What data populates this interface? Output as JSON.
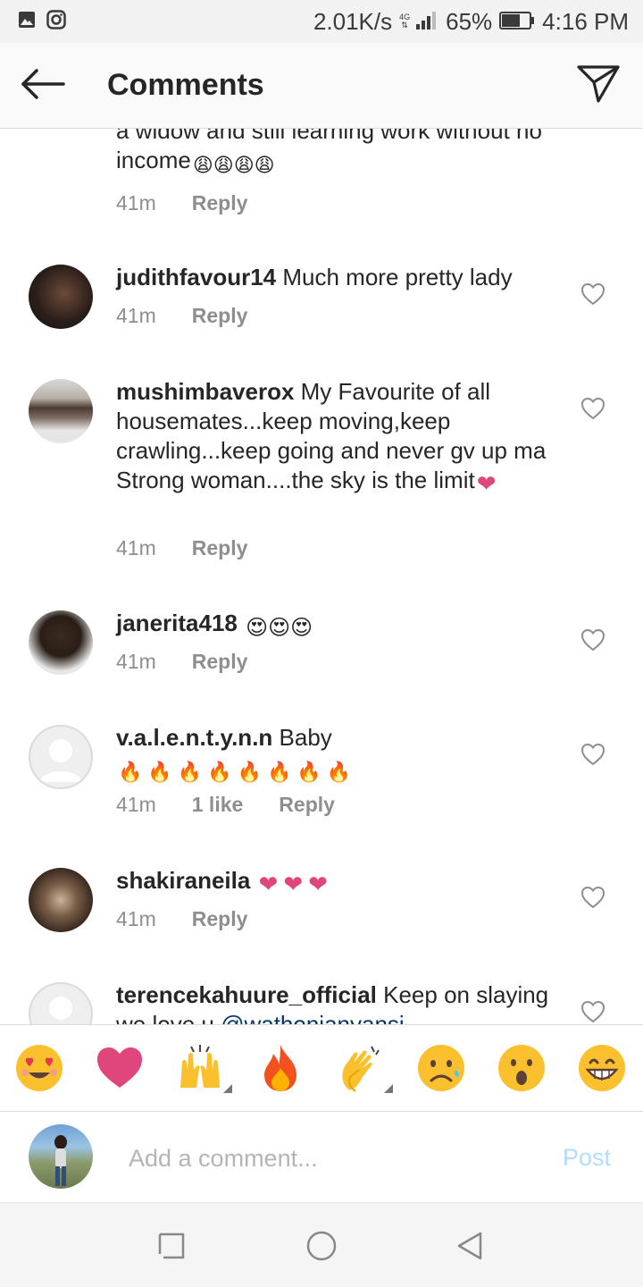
{
  "status_bar": {
    "speed": "2.01K/s",
    "network": "4G",
    "battery": "65%",
    "time": "4:16 PM",
    "icons": [
      "gallery-icon",
      "instagram-icon",
      "signal-icon",
      "battery-icon"
    ]
  },
  "header": {
    "title": "Comments",
    "back_icon": "arrow-left-icon",
    "share_icon": "paper-plane-icon"
  },
  "comments": [
    {
      "username": "",
      "text": "a widow and still learning work without no income",
      "emojis": "😩😩😩😩",
      "time": "41m",
      "likes": "",
      "reply": "Reply"
    },
    {
      "username": "judithfavour14",
      "text": "Much more pretty lady",
      "emojis": "",
      "time": "41m",
      "likes": "",
      "reply": "Reply"
    },
    {
      "username": "mushimbaverox",
      "text": "My Favourite of all housemates...keep moving,keep crawling...keep going and never gv up ma Strong woman....the sky is the limit",
      "emojis": "❤",
      "time": "41m",
      "likes": "",
      "reply": "Reply"
    },
    {
      "username": "janerita418",
      "text": "",
      "emojis": "😍😍😍",
      "time": "41m",
      "likes": "",
      "reply": "Reply"
    },
    {
      "username": "v.a.l.e.n.t.y.n.n",
      "text": "Baby",
      "emojis": "🔥🔥🔥🔥🔥🔥🔥🔥",
      "time": "41m",
      "likes": "1 like",
      "reply": "Reply"
    },
    {
      "username": "shakiraneila",
      "text": "",
      "emojis": "❤❤❤",
      "time": "41m",
      "likes": "",
      "reply": "Reply"
    },
    {
      "username": "terencekahuure_official",
      "text": "Keep on slaying we love u",
      "mention": "@wathonianyansi",
      "time": "",
      "likes": "",
      "reply": ""
    }
  ],
  "emoji_bar": [
    "heart-eyes",
    "red-heart",
    "raising-hands",
    "fire",
    "clapping-hands",
    "frowning-face",
    "astonished-face",
    "grinning-face"
  ],
  "composer": {
    "placeholder": "Add a comment...",
    "post_label": "Post"
  },
  "nav_bar": [
    "recents-icon",
    "home-icon",
    "back-icon"
  ],
  "colors": {
    "heart_pink": "#e0457b",
    "post_disabled": "#b3dbff",
    "meta_gray": "#8e8e8e",
    "mention_blue": "#003569"
  }
}
